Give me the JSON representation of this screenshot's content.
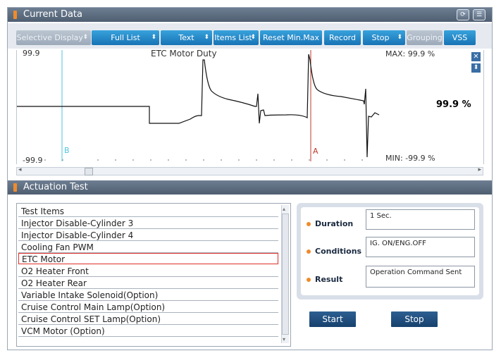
{
  "window": {
    "title": "Current Data",
    "icons": [
      "refresh-icon",
      "list-view-icon"
    ]
  },
  "toolbar": {
    "buttons": [
      {
        "label": "Selective Display",
        "arrow": "⬍",
        "enabled": false
      },
      {
        "label": "Full List",
        "arrow": "⬍",
        "enabled": true
      },
      {
        "label": "Text",
        "arrow": "⬍",
        "enabled": true
      },
      {
        "label": "Items List",
        "arrow": "⬍",
        "enabled": true
      },
      {
        "label": "Reset Min.Max",
        "arrow": "",
        "enabled": true
      },
      {
        "label": "Record",
        "arrow": "",
        "enabled": true
      },
      {
        "label": "Stop",
        "arrow": "⬍",
        "enabled": true
      },
      {
        "label": "Grouping",
        "arrow": "",
        "enabled": false
      },
      {
        "label": "VSS",
        "arrow": "",
        "enabled": true
      }
    ]
  },
  "graph": {
    "title": "ETC Motor Duty",
    "y_max_label": "99.9",
    "y_min_label": "-99.9",
    "cursor_a": "A",
    "cursor_b": "B",
    "max_text": "MAX:  99.9 %",
    "min_text": "MIN:  -99.9 %",
    "current_value": "99.9 %",
    "close_symbol": "✕",
    "expand_symbol": "⬍",
    "colors": {
      "trace": "#111111",
      "cursor_a": "#c0392b",
      "cursor_b": "#4fc3e0"
    }
  },
  "actuation": {
    "title": "Actuation Test",
    "list_header": "Test Items",
    "items": [
      "Injector Disable-Cylinder 3",
      "Injector Disable-Cylinder 4",
      "Cooling Fan PWM",
      "ETC Motor",
      "O2 Heater Front",
      "O2 Heater Rear",
      "Variable Intake Solenoid(Option)",
      "Cruise Control Main Lamp(Option)",
      "Cruise Control SET Lamp(Option)",
      "VCM Motor (Option)"
    ],
    "selected_index": 3,
    "duration_label": "Duration",
    "duration_value": "1 Sec.",
    "conditions_label": "Conditions",
    "conditions_value": "IG. ON/ENG.OFF",
    "result_label": "Result",
    "result_value": "Operation Command Sent",
    "start_label": "Start",
    "stop_label": "Stop"
  }
}
